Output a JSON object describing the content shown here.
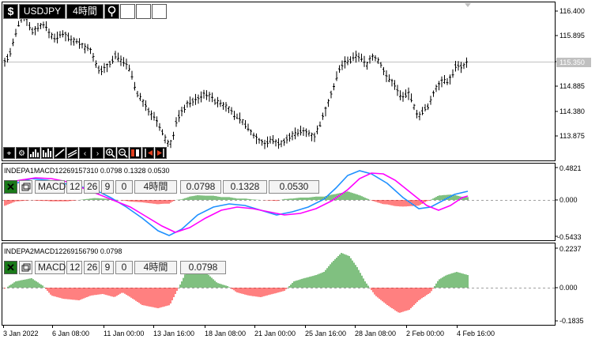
{
  "toolbar": {
    "symbol": "USDJPY",
    "timeframe": "4時間",
    "dollar_icon": "dollar-icon",
    "pin_icon": "pin-icon"
  },
  "main_chart": {
    "price_labels": [
      "116.400",
      "115.895",
      "115.350",
      "114.885",
      "114.380",
      "113.875"
    ],
    "current_price": "115.350"
  },
  "indicator1": {
    "title": "INDEPA1MACD12269157310 0.0798 0.1328 0.0530",
    "chips": [
      "MACD",
      "12",
      "26",
      "9",
      "0",
      "4時間",
      "0.0798",
      "0.1328",
      "0.0530"
    ],
    "axis_labels": [
      "0.4821",
      "0.000",
      "-0.5433"
    ]
  },
  "indicator2": {
    "title": "INDEPA2MACD12269156790 0.0798",
    "chips": [
      "MACD",
      "12",
      "26",
      "9",
      "0",
      "4時間",
      "0.0798"
    ],
    "axis_labels": [
      "0.2237",
      "0.000",
      "-0.1835"
    ]
  },
  "time_labels": [
    "3 Jan 2022",
    "6 Jan 08:00",
    "11 Jan 00:00",
    "13 Jan 16:00",
    "18 Jan 08:00",
    "21 Jan 00:00",
    "25 Jan 16:00",
    "28 Jan 08:00",
    "2 Feb 00:00",
    "4 Feb 16:00"
  ],
  "colors": {
    "up_hist": "#008000",
    "down_hist": "#ff0000",
    "macd_line": "#1e90ff",
    "signal_line": "#ff00ff",
    "candle": "#000000",
    "price_label_bg": "#c0c0c0"
  }
}
